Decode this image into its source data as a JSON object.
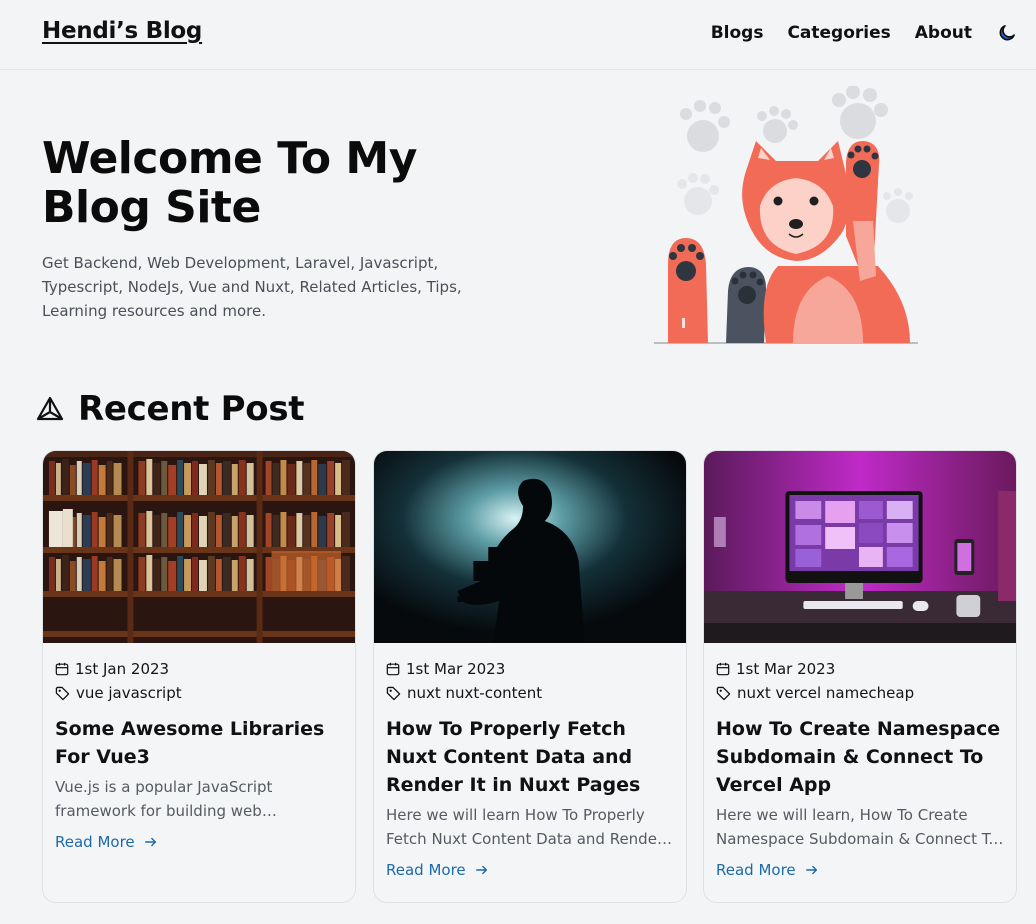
{
  "header": {
    "brand": "Hendi’s Blog",
    "nav": [
      {
        "label": "Blogs"
      },
      {
        "label": "Categories"
      },
      {
        "label": "About"
      }
    ],
    "theme_icon": "moon-icon"
  },
  "hero": {
    "title": "Welcome To My Blog Site",
    "description": "Get Backend, Web Development, Laravel, Javascript, Typescript, NodeJs, Vue and Nuxt, Related Articles, Tips, Learning resources and more.",
    "illustration": "shiba-dog-waving-paws"
  },
  "recent": {
    "title": "Recent Post",
    "icon": "nuxt-logo-icon"
  },
  "posts": [
    {
      "date": "1st Jan 2023",
      "tags": "vue javascript",
      "title": "Some Awesome Libraries For Vue3",
      "description": "Vue.js is a popular JavaScript framework for building web applications",
      "read_more": "Read More",
      "image": "bookshelf-photo"
    },
    {
      "date": "1st Mar 2023",
      "tags": "nuxt nuxt-content",
      "title": "How To Properly Fetch Nuxt Content Data and Render It in Nuxt Pages",
      "description": "Here we will learn How To Properly Fetch Nuxt Content Data and Render It in Nuxt Pages",
      "read_more": "Read More",
      "image": "camera-operator-silhouette-photo"
    },
    {
      "date": "1st Mar 2023",
      "tags": "nuxt vercel namecheap",
      "title": "How To Create Namespace Subdomain & Connect To Vercel App",
      "description": "Here we will learn, How To Create Namespace Subdomain & Connect To Vercel App",
      "read_more": "Read More",
      "image": "pink-desk-setup-photo"
    }
  ],
  "colors": {
    "background": "#f3f4f6",
    "link": "#1d6aa8",
    "dog": "#f26b56",
    "moon": "#1d4ed8"
  }
}
